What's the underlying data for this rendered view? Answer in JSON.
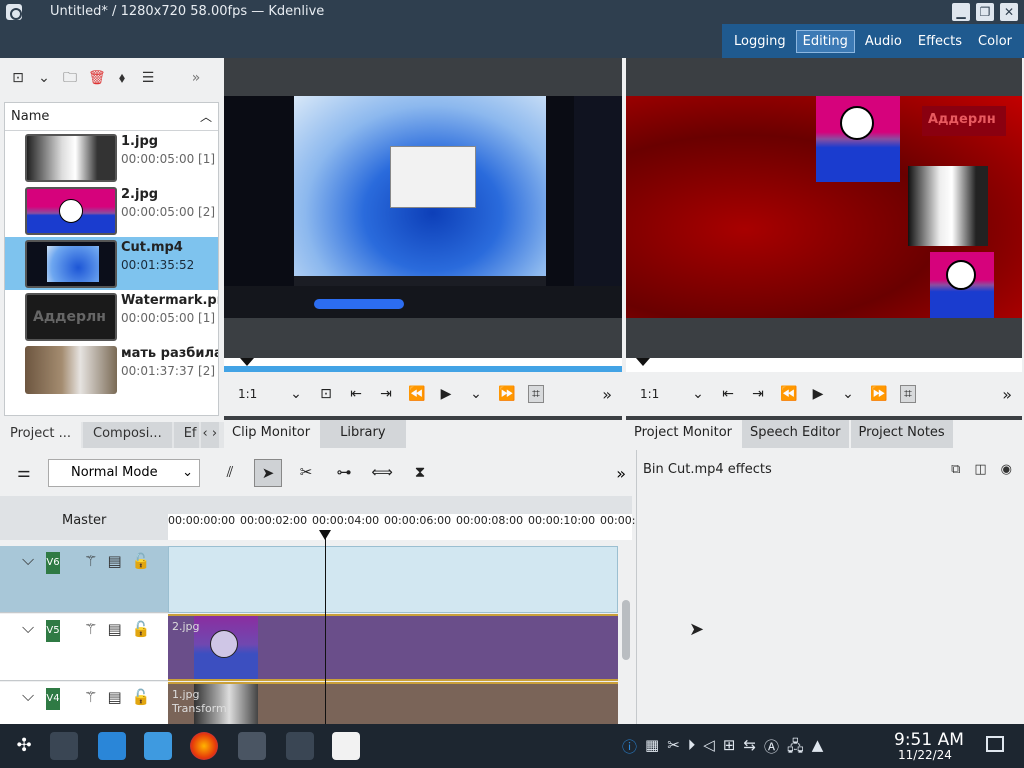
{
  "window": {
    "title": "Untitled* / 1280x720 58.00fps — Kdenlive",
    "buttons": [
      "▁",
      "❐",
      "✕"
    ]
  },
  "workspaces": {
    "tabs": [
      "Logging",
      "Editing",
      "Audio",
      "Effects",
      "Color"
    ],
    "active": "Editing"
  },
  "bin": {
    "header": "Name",
    "items": [
      {
        "name": "1.jpg",
        "duration": "00:00:05:00 [1]"
      },
      {
        "name": "2.jpg",
        "duration": "00:00:05:00 [2]"
      },
      {
        "name": "Cut.mp4",
        "duration": "00:01:35:52"
      },
      {
        "name": "Watermark.png",
        "duration": "00:00:05:00 [1]"
      },
      {
        "name": "мать разбила",
        "duration": "00:01:37:37 [2]"
      }
    ],
    "watermark_text": "Аддерлн",
    "tabs": [
      "Project ...",
      "Composi...",
      "Ef"
    ]
  },
  "clip_monitor": {
    "zoom": "1:1",
    "tabs": [
      "Clip Monitor",
      "Library"
    ]
  },
  "project_monitor": {
    "zoom": "1:1",
    "tabs": [
      "Project Monitor",
      "Speech Editor",
      "Project Notes"
    ],
    "overlay_text": "Аддерлн"
  },
  "timeline": {
    "mode": "Normal Mode",
    "master_label": "Master",
    "ruler_ticks": [
      "00:00:00:00",
      "00:00:02:00",
      "00:00:04:00",
      "00:00:06:00",
      "00:00:08:00",
      "00:00:10:00",
      "00:00:1"
    ],
    "tracks": [
      {
        "name": "V6",
        "clip_label": ""
      },
      {
        "name": "V5",
        "clip_label": "2.jpg"
      },
      {
        "name": "V4",
        "clip_label": "1.jpg",
        "sub_label": "Transform"
      }
    ]
  },
  "effects_panel": {
    "title": "Bin Cut.mp4 effects"
  },
  "taskbar": {
    "time": "9:51 AM",
    "date": "11/22/24"
  },
  "colors": {
    "accent": "#1f5a8f",
    "selection": "#7ec3ee",
    "track_v5": "#6a4e8a",
    "track_v4": "#7a6458"
  }
}
